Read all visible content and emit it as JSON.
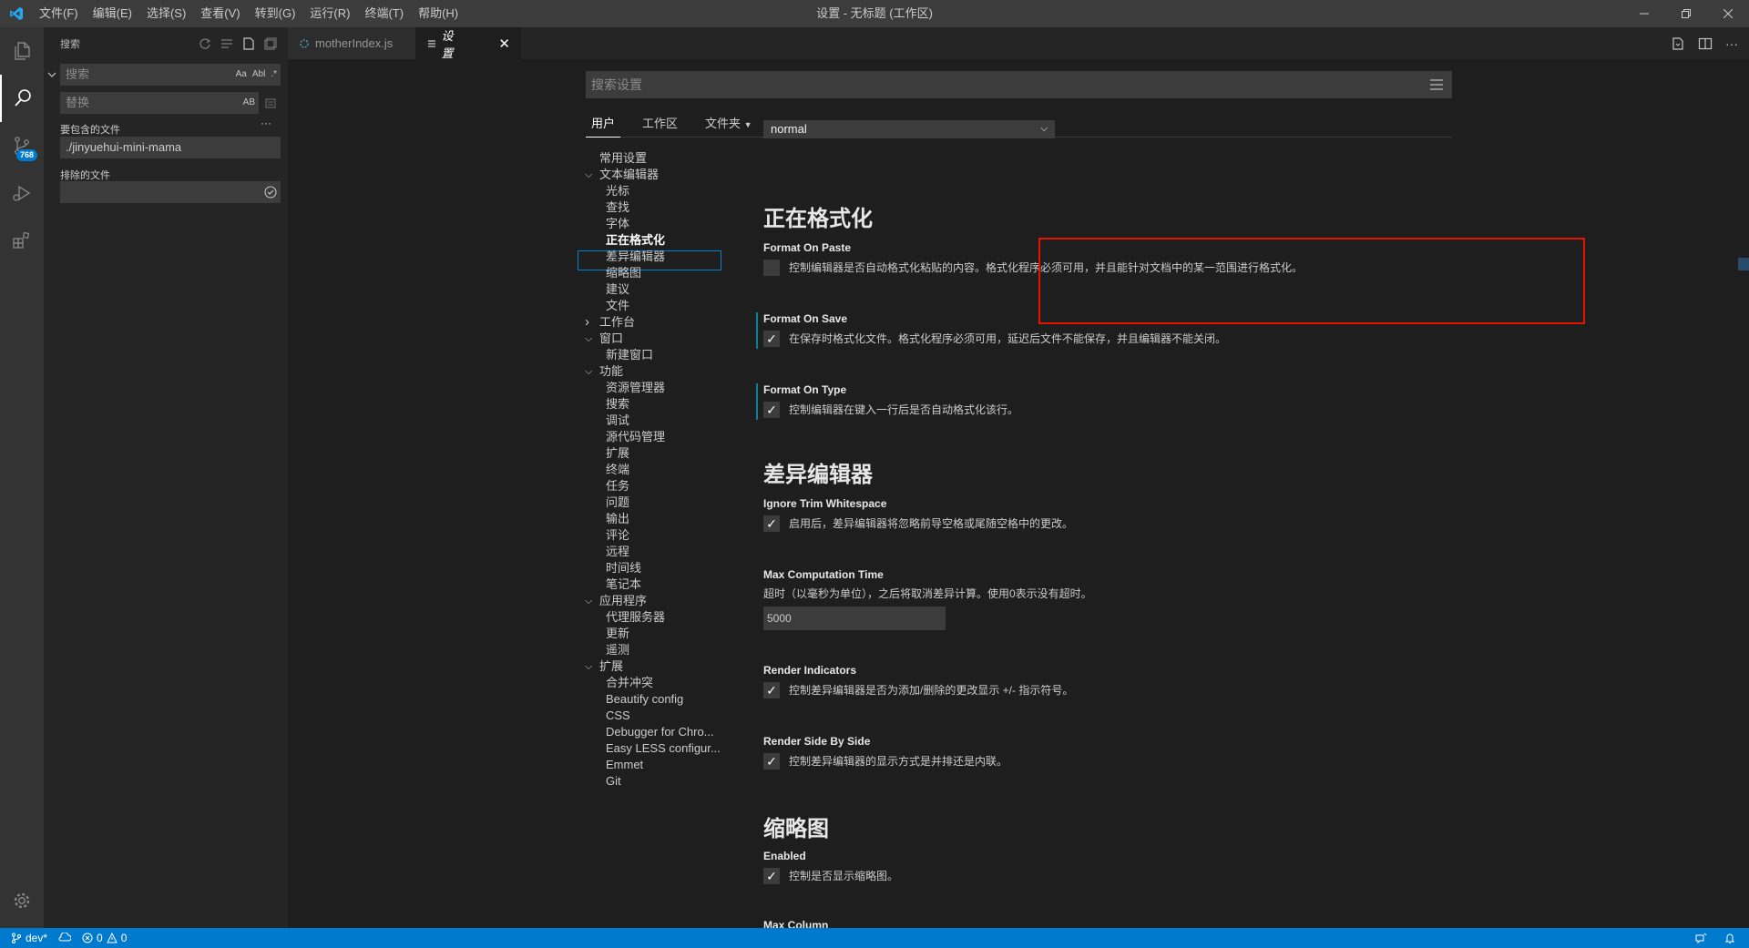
{
  "titlebar": {
    "menu": [
      "文件(F)",
      "编辑(E)",
      "选择(S)",
      "查看(V)",
      "转到(G)",
      "运行(R)",
      "终端(T)",
      "帮助(H)"
    ],
    "window_title": "设置 - 无标题 (工作区)"
  },
  "activitybar": {
    "scm_badge": "768"
  },
  "sidebar": {
    "title": "搜索",
    "search_placeholder": "搜索",
    "replace_placeholder": "替换",
    "search_opts": [
      "Aa",
      "Abl",
      ".*"
    ],
    "replace_opt": "AB",
    "include_label": "要包含的文件",
    "include_value": "./jinyuehui-mini-mama",
    "exclude_label": "排除的文件",
    "exclude_value": "",
    "more": "···"
  },
  "tabs": [
    {
      "label": "motherIndex.js",
      "active": false
    },
    {
      "label": "设置",
      "active": true
    }
  ],
  "settings": {
    "search_placeholder": "搜索设置",
    "scopes": [
      "用户",
      "工作区",
      "文件夹"
    ],
    "toc": [
      {
        "label": "常用设置",
        "level": 0
      },
      {
        "label": "文本编辑器",
        "level": 0,
        "chevron": "open"
      },
      {
        "label": "光标",
        "level": 1
      },
      {
        "label": "查找",
        "level": 1
      },
      {
        "label": "字体",
        "level": 1
      },
      {
        "label": "正在格式化",
        "level": 1,
        "selected": true
      },
      {
        "label": "差异编辑器",
        "level": 1
      },
      {
        "label": "缩略图",
        "level": 1
      },
      {
        "label": "建议",
        "level": 1
      },
      {
        "label": "文件",
        "level": 1
      },
      {
        "label": "工作台",
        "level": 0,
        "chevron": "closed"
      },
      {
        "label": "窗口",
        "level": 0,
        "chevron": "open"
      },
      {
        "label": "新建窗口",
        "level": 1
      },
      {
        "label": "功能",
        "level": 0,
        "chevron": "open"
      },
      {
        "label": "资源管理器",
        "level": 1
      },
      {
        "label": "搜索",
        "level": 1
      },
      {
        "label": "调试",
        "level": 1
      },
      {
        "label": "源代码管理",
        "level": 1
      },
      {
        "label": "扩展",
        "level": 1
      },
      {
        "label": "终端",
        "level": 1
      },
      {
        "label": "任务",
        "level": 1
      },
      {
        "label": "问题",
        "level": 1
      },
      {
        "label": "输出",
        "level": 1
      },
      {
        "label": "评论",
        "level": 1
      },
      {
        "label": "远程",
        "level": 1
      },
      {
        "label": "时间线",
        "level": 1
      },
      {
        "label": "笔记本",
        "level": 1
      },
      {
        "label": "应用程序",
        "level": 0,
        "chevron": "open"
      },
      {
        "label": "代理服务器",
        "level": 1
      },
      {
        "label": "更新",
        "level": 1
      },
      {
        "label": "遥测",
        "level": 1
      },
      {
        "label": "扩展",
        "level": 0,
        "chevron": "open"
      },
      {
        "label": "合并冲突",
        "level": 1
      },
      {
        "label": "Beautify config",
        "level": 1
      },
      {
        "label": "CSS",
        "level": 1
      },
      {
        "label": "Debugger for Chro...",
        "level": 1
      },
      {
        "label": "Easy LESS configur...",
        "level": 1
      },
      {
        "label": "Emmet",
        "level": 1
      },
      {
        "label": "Git",
        "level": 1
      }
    ],
    "dropdown_value": "normal",
    "formatting": {
      "heading": "正在格式化",
      "paste_title": "Format On Paste",
      "paste_desc": "控制编辑器是否自动格式化粘贴的内容。格式化程序必须可用，并且能针对文档中的某一范围进行格式化。",
      "save_title": "Format On Save",
      "save_desc": "在保存时格式化文件。格式化程序必须可用，延迟后文件不能保存，并且编辑器不能关闭。",
      "type_title": "Format On Type",
      "type_desc": "控制编辑器在键入一行后是否自动格式化该行。"
    },
    "diff": {
      "heading": "差异编辑器",
      "trim_title": "Ignore Trim Whitespace",
      "trim_desc": "启用后，差异编辑器将忽略前导空格或尾随空格中的更改。",
      "maxtime_title": "Max Computation Time",
      "maxtime_desc": "超时（以毫秒为单位），之后将取消差异计算。使用0表示没有超时。",
      "maxtime_value": "5000",
      "indicators_title": "Render Indicators",
      "indicators_desc": "控制差异编辑器是否为添加/删除的更改显示 +/- 指示符号。",
      "sidebyside_title": "Render Side By Side",
      "sidebyside_desc": "控制差异编辑器的显示方式是并排还是内联。"
    },
    "minimap": {
      "heading": "缩略图",
      "enabled_title": "Enabled",
      "enabled_desc": "控制是否显示缩略图。",
      "maxcol_title": "Max Column"
    },
    "checkmark": "✓"
  },
  "statusbar": {
    "branch": "dev*",
    "errors": "0",
    "warnings": "0"
  },
  "colors": {
    "accent": "#007acc",
    "highlight_border": "#e51400"
  }
}
